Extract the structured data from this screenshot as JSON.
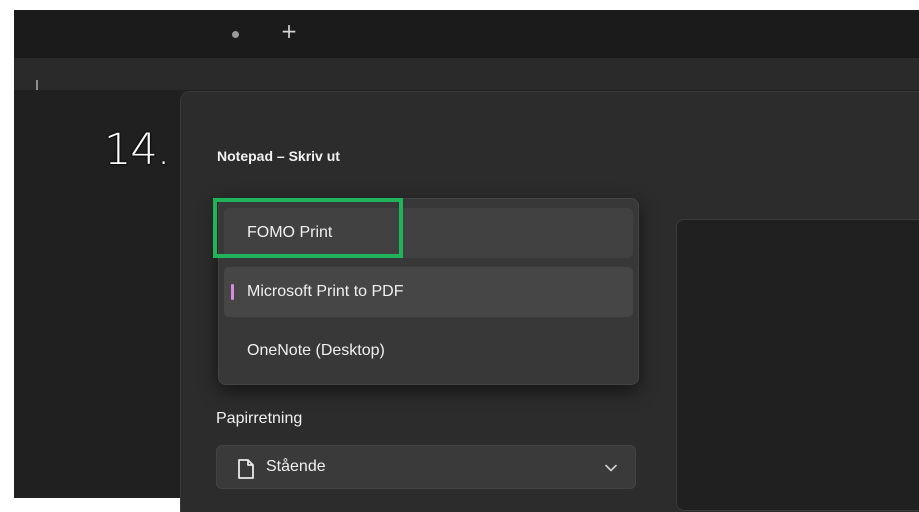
{
  "step": {
    "number": "14."
  },
  "tabs": {
    "new_tab": "+"
  },
  "dialog": {
    "title": "Notepad – Skriv ut",
    "printers": [
      {
        "label": "FOMO Print",
        "state": "highlighted"
      },
      {
        "label": "Microsoft Print to PDF",
        "state": "selected"
      },
      {
        "label": "OneNote (Desktop)",
        "state": "normal"
      }
    ],
    "orientation": {
      "label": "Papirretning",
      "value": "Stående"
    }
  },
  "colors": {
    "highlight_box": "#1fb45a",
    "selection_accent": "#d68bdc"
  },
  "icons": {
    "orientation": "page-icon",
    "dropdown": "chevron-down-icon"
  }
}
